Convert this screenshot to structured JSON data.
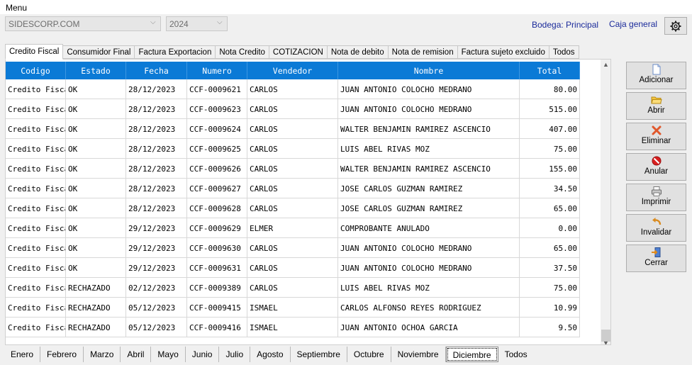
{
  "menu": {
    "label": "Menu"
  },
  "header": {
    "company": "SIDESCORP.COM",
    "year": "2024",
    "bodega": "Bodega: Principal",
    "caja": "Caja general"
  },
  "tabs": [
    {
      "label": "Credito Fiscal",
      "active": true
    },
    {
      "label": "Consumidor Final"
    },
    {
      "label": "Factura Exportacion"
    },
    {
      "label": "Nota Credito"
    },
    {
      "label": "COTIZACION"
    },
    {
      "label": "Nota de debito"
    },
    {
      "label": "Nota de remision"
    },
    {
      "label": "Factura sujeto excluido"
    },
    {
      "label": "Todos"
    }
  ],
  "grid": {
    "columns": [
      "Codigo",
      "Estado",
      "Fecha",
      "Numero",
      "Vendedor",
      "Nombre",
      "Total"
    ],
    "rows": [
      [
        "Credito Fiscal",
        "OK",
        "28/12/2023",
        "CCF-0009621",
        "CARLOS",
        "JUAN ANTONIO COLOCHO MEDRANO",
        "80.00"
      ],
      [
        "Credito Fiscal",
        "OK",
        "28/12/2023",
        "CCF-0009623",
        "CARLOS",
        "JUAN ANTONIO COLOCHO MEDRANO",
        "515.00"
      ],
      [
        "Credito Fiscal",
        "OK",
        "28/12/2023",
        "CCF-0009624",
        "CARLOS",
        "WALTER BENJAMIN RAMIREZ ASCENCIO",
        "407.00"
      ],
      [
        "Credito Fiscal",
        "OK",
        "28/12/2023",
        "CCF-0009625",
        "CARLOS",
        "LUIS ABEL RIVAS MOZ",
        "75.00"
      ],
      [
        "Credito Fiscal",
        "OK",
        "28/12/2023",
        "CCF-0009626",
        "CARLOS",
        "WALTER BENJAMIN RAMIREZ ASCENCIO",
        "155.00"
      ],
      [
        "Credito Fiscal",
        "OK",
        "28/12/2023",
        "CCF-0009627",
        "CARLOS",
        "JOSE CARLOS GUZMAN RAMIREZ",
        "34.50"
      ],
      [
        "Credito Fiscal",
        "OK",
        "28/12/2023",
        "CCF-0009628",
        "CARLOS",
        "JOSE CARLOS GUZMAN RAMIREZ",
        "65.00"
      ],
      [
        "Credito Fiscal",
        "OK",
        "29/12/2023",
        "CCF-0009629",
        "ELMER",
        "COMPROBANTE ANULADO",
        "0.00"
      ],
      [
        "Credito Fiscal",
        "OK",
        "29/12/2023",
        "CCF-0009630",
        "CARLOS",
        "JUAN ANTONIO COLOCHO MEDRANO",
        "65.00"
      ],
      [
        "Credito Fiscal",
        "OK",
        "29/12/2023",
        "CCF-0009631",
        "CARLOS",
        "JUAN ANTONIO COLOCHO MEDRANO",
        "37.50"
      ],
      [
        "Credito Fiscal",
        "RECHAZADO",
        "02/12/2023",
        "CCF-0009389",
        "CARLOS",
        "LUIS ABEL RIVAS MOZ",
        "75.00"
      ],
      [
        "Credito Fiscal",
        "RECHAZADO",
        "05/12/2023",
        "CCF-0009415",
        "ISMAEL",
        "CARLOS ALFONSO REYES RODRIGUEZ",
        "10.99"
      ],
      [
        "Credito Fiscal",
        "RECHAZADO",
        "05/12/2023",
        "CCF-0009416",
        "ISMAEL",
        "JUAN ANTONIO OCHOA GARCIA",
        "9.50"
      ]
    ]
  },
  "actions": [
    {
      "label": "Adicionar",
      "icon": "new-document-icon"
    },
    {
      "label": "Abrir",
      "icon": "open-folder-icon"
    },
    {
      "label": "Eliminar",
      "icon": "delete-icon"
    },
    {
      "label": "Anular",
      "icon": "cancel-icon"
    },
    {
      "label": "Imprimir",
      "icon": "printer-icon"
    },
    {
      "label": "Invalidar",
      "icon": "undo-icon"
    },
    {
      "label": "Cerrar",
      "icon": "close-door-icon"
    }
  ],
  "months": [
    {
      "label": "Enero"
    },
    {
      "label": "Febrero"
    },
    {
      "label": "Marzo"
    },
    {
      "label": "Abril"
    },
    {
      "label": "Mayo"
    },
    {
      "label": "Junio"
    },
    {
      "label": "Julio"
    },
    {
      "label": "Agosto"
    },
    {
      "label": "Septiembre"
    },
    {
      "label": "Octubre"
    },
    {
      "label": "Noviembre"
    },
    {
      "label": "Diciembre",
      "active": true
    },
    {
      "label": "Todos"
    }
  ],
  "colors": {
    "header_blue": "#0b7ad6",
    "link_blue": "#1a2a9a"
  }
}
